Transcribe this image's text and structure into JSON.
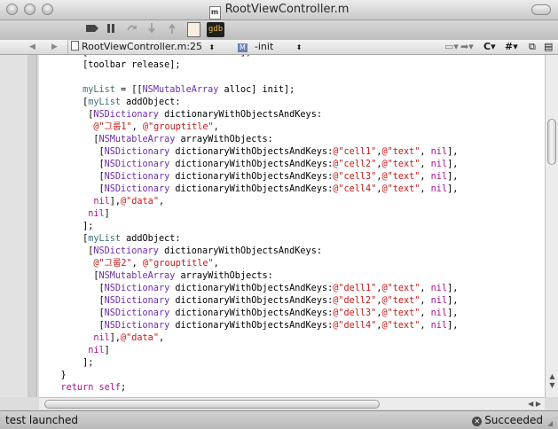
{
  "window": {
    "title": "RootViewController.m",
    "file_icon_letter": "m"
  },
  "toolbar": {
    "buttons": [
      "breakpoints-toggle",
      "pause",
      "step-over",
      "step-into",
      "step-out"
    ],
    "gdb_label": "gdb"
  },
  "navbar": {
    "back": "◀",
    "forward": "▶",
    "file_position": "RootViewController.m:25",
    "method_badge": "M",
    "method": "-init",
    "right_controls": [
      "C",
      "#"
    ]
  },
  "code": {
    "lines": [
      [
        [
          "plain",
          "        [self.view addSubview:toolbar];"
        ]
      ],
      [
        [
          "plain",
          "        [toolbar release];"
        ]
      ],
      [
        [
          "plain",
          ""
        ]
      ],
      [
        [
          "var",
          "        myList"
        ],
        [
          "plain",
          " = [["
        ],
        [
          "cls",
          "NSMutableArray"
        ],
        [
          "plain",
          " alloc] init];"
        ]
      ],
      [
        [
          "plain",
          "        ["
        ],
        [
          "var",
          "myList"
        ],
        [
          "plain",
          " addObject:"
        ]
      ],
      [
        [
          "plain",
          "         ["
        ],
        [
          "cls",
          "NSDictionary"
        ],
        [
          "plain",
          " dictionaryWithObjectsAndKeys:"
        ]
      ],
      [
        [
          "str",
          "          @\"그룹1\""
        ],
        [
          "plain",
          ", "
        ],
        [
          "str",
          "@\"grouptitle\""
        ],
        [
          "plain",
          ","
        ]
      ],
      [
        [
          "plain",
          "          ["
        ],
        [
          "cls",
          "NSMutableArray"
        ],
        [
          "plain",
          " arrayWithObjects:"
        ]
      ],
      [
        [
          "plain",
          "           ["
        ],
        [
          "cls",
          "NSDictionary"
        ],
        [
          "plain",
          " dictionaryWithObjectsAndKeys:"
        ],
        [
          "str",
          "@\"cell1\""
        ],
        [
          "plain",
          ","
        ],
        [
          "str",
          "@\"text\""
        ],
        [
          "plain",
          ", "
        ],
        [
          "kw",
          "nil"
        ],
        [
          "plain",
          "],"
        ]
      ],
      [
        [
          "plain",
          "           ["
        ],
        [
          "cls",
          "NSDictionary"
        ],
        [
          "plain",
          " dictionaryWithObjectsAndKeys:"
        ],
        [
          "str",
          "@\"cell2\""
        ],
        [
          "plain",
          ","
        ],
        [
          "str",
          "@\"text\""
        ],
        [
          "plain",
          ", "
        ],
        [
          "kw",
          "nil"
        ],
        [
          "plain",
          "],"
        ]
      ],
      [
        [
          "plain",
          "           ["
        ],
        [
          "cls",
          "NSDictionary"
        ],
        [
          "plain",
          " dictionaryWithObjectsAndKeys:"
        ],
        [
          "str",
          "@\"cell3\""
        ],
        [
          "plain",
          ","
        ],
        [
          "str",
          "@\"text\""
        ],
        [
          "plain",
          ", "
        ],
        [
          "kw",
          "nil"
        ],
        [
          "plain",
          "],"
        ]
      ],
      [
        [
          "plain",
          "           ["
        ],
        [
          "cls",
          "NSDictionary"
        ],
        [
          "plain",
          " dictionaryWithObjectsAndKeys:"
        ],
        [
          "str",
          "@\"cell4\""
        ],
        [
          "plain",
          ","
        ],
        [
          "str",
          "@\"text\""
        ],
        [
          "plain",
          ", "
        ],
        [
          "kw",
          "nil"
        ],
        [
          "plain",
          "],"
        ]
      ],
      [
        [
          "kw",
          "          nil"
        ],
        [
          "plain",
          "],"
        ],
        [
          "str",
          "@\"data\""
        ],
        [
          "plain",
          ","
        ]
      ],
      [
        [
          "kw",
          "         nil"
        ],
        [
          "plain",
          "]"
        ]
      ],
      [
        [
          "plain",
          "        ];"
        ]
      ],
      [
        [
          "plain",
          "        ["
        ],
        [
          "var",
          "myList"
        ],
        [
          "plain",
          " addObject:"
        ]
      ],
      [
        [
          "plain",
          "         ["
        ],
        [
          "cls",
          "NSDictionary"
        ],
        [
          "plain",
          " dictionaryWithObjectsAndKeys:"
        ]
      ],
      [
        [
          "str",
          "          @\"그룹2\""
        ],
        [
          "plain",
          ", "
        ],
        [
          "str",
          "@\"grouptitle\""
        ],
        [
          "plain",
          ","
        ]
      ],
      [
        [
          "plain",
          "          ["
        ],
        [
          "cls",
          "NSMutableArray"
        ],
        [
          "plain",
          " arrayWithObjects:"
        ]
      ],
      [
        [
          "plain",
          "           ["
        ],
        [
          "cls",
          "NSDictionary"
        ],
        [
          "plain",
          " dictionaryWithObjectsAndKeys:"
        ],
        [
          "str",
          "@\"dell1\""
        ],
        [
          "plain",
          ","
        ],
        [
          "str",
          "@\"text\""
        ],
        [
          "plain",
          ", "
        ],
        [
          "kw",
          "nil"
        ],
        [
          "plain",
          "],"
        ]
      ],
      [
        [
          "plain",
          "           ["
        ],
        [
          "cls",
          "NSDictionary"
        ],
        [
          "plain",
          " dictionaryWithObjectsAndKeys:"
        ],
        [
          "str",
          "@\"dell2\""
        ],
        [
          "plain",
          ","
        ],
        [
          "str",
          "@\"text\""
        ],
        [
          "plain",
          ", "
        ],
        [
          "kw",
          "nil"
        ],
        [
          "plain",
          "],"
        ]
      ],
      [
        [
          "plain",
          "           ["
        ],
        [
          "cls",
          "NSDictionary"
        ],
        [
          "plain",
          " dictionaryWithObjectsAndKeys:"
        ],
        [
          "str",
          "@\"dell3\""
        ],
        [
          "plain",
          ","
        ],
        [
          "str",
          "@\"text\""
        ],
        [
          "plain",
          ", "
        ],
        [
          "kw",
          "nil"
        ],
        [
          "plain",
          "],"
        ]
      ],
      [
        [
          "plain",
          "           ["
        ],
        [
          "cls",
          "NSDictionary"
        ],
        [
          "plain",
          " dictionaryWithObjectsAndKeys:"
        ],
        [
          "str",
          "@\"dell4\""
        ],
        [
          "plain",
          ","
        ],
        [
          "str",
          "@\"text\""
        ],
        [
          "plain",
          ", "
        ],
        [
          "kw",
          "nil"
        ],
        [
          "plain",
          "],"
        ]
      ],
      [
        [
          "kw",
          "          nil"
        ],
        [
          "plain",
          "],"
        ],
        [
          "str",
          "@\"data\""
        ],
        [
          "plain",
          ","
        ]
      ],
      [
        [
          "kw",
          "         nil"
        ],
        [
          "plain",
          "]"
        ]
      ],
      [
        [
          "plain",
          "        ];"
        ]
      ],
      [
        [
          "plain",
          "    }"
        ]
      ],
      [
        [
          "kw",
          "    return"
        ],
        [
          "plain",
          " "
        ],
        [
          "kw",
          "self"
        ],
        [
          "plain",
          ";"
        ]
      ]
    ]
  },
  "statusbar": {
    "left_text": "test launched",
    "right_text": "Succeeded"
  },
  "colors": {
    "keyword": "#a9108f",
    "string": "#c41a16",
    "class": "#6c2dab",
    "variable": "#3f6e74"
  }
}
